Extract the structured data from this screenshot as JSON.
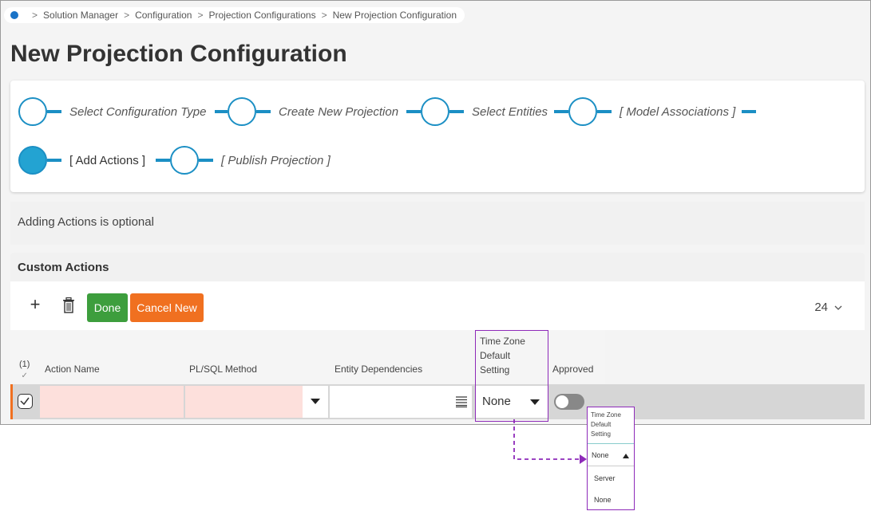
{
  "breadcrumb": {
    "items": [
      "Solution Manager",
      "Configuration",
      "Projection Configurations",
      "New Projection Configuration"
    ],
    "separator": ">"
  },
  "page": {
    "title": "New Projection Configuration"
  },
  "wizard": {
    "steps": [
      {
        "label": "Select Configuration Type",
        "active": false
      },
      {
        "label": "Create New Projection",
        "active": false
      },
      {
        "label": "Select Entities",
        "active": false
      },
      {
        "label": "[ Model Associations ]",
        "active": false
      },
      {
        "label": "[ Add Actions ]",
        "active": true
      },
      {
        "label": "[ Publish Projection ]",
        "active": false
      }
    ],
    "accent_color": "#1b8fc4"
  },
  "info": {
    "text": "Adding Actions is optional"
  },
  "section": {
    "title": "Custom Actions"
  },
  "toolbar": {
    "add_icon": "plus-icon",
    "delete_icon": "trash-icon",
    "done_label": "Done",
    "cancel_label": "Cancel New",
    "page_size": "24",
    "done_color": "#3d9e3d",
    "cancel_color": "#f07020"
  },
  "grid": {
    "selected_count": "(1)",
    "columns": {
      "action_name": "Action Name",
      "plsql_method": "PL/SQL Method",
      "entity_dependencies": "Entity Dependencies",
      "tz_line1": "Time Zone",
      "tz_line2": "Default",
      "tz_line3": "Setting",
      "approved": "Approved"
    },
    "row": {
      "tz_value": "None",
      "approved": false
    }
  },
  "callout": {
    "head_line1": "Time Zone",
    "head_line2": "Default",
    "head_line3": "Setting",
    "selected": "None",
    "options": [
      "Server",
      "None"
    ],
    "highlight_color": "#8e2ab9"
  }
}
